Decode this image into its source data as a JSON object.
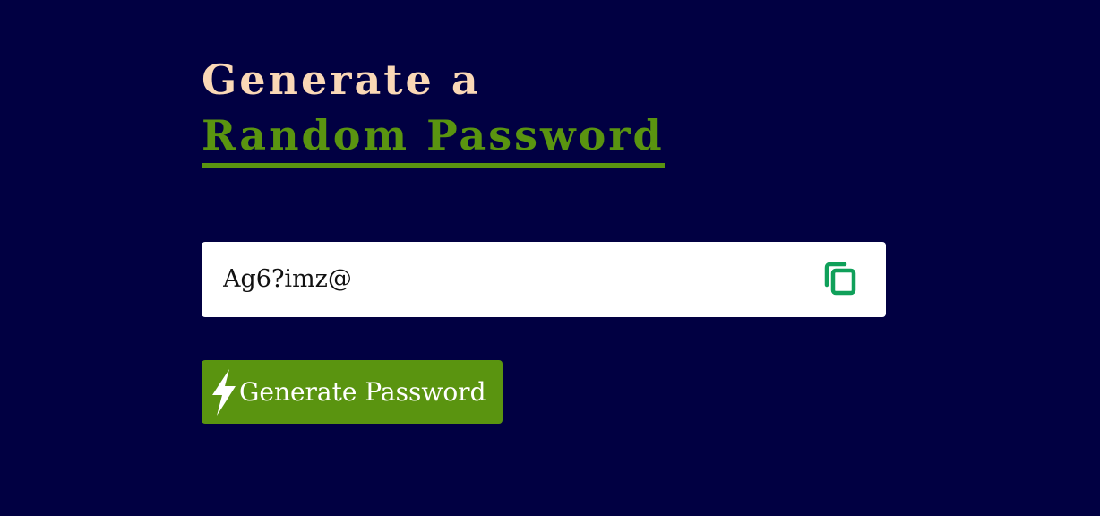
{
  "heading": {
    "line1": "Generate a",
    "line2": "Random Password"
  },
  "password_field": {
    "value": "Ag6?imz@"
  },
  "copy_button": {
    "icon": "copy-icon"
  },
  "generate_button": {
    "label": "Generate Password",
    "icon": "lightning-icon"
  },
  "colors": {
    "background": "#010042",
    "heading_accent": "#FAD8B6",
    "brand_green": "#5A9410",
    "copy_icon_green": "#10A05A"
  }
}
